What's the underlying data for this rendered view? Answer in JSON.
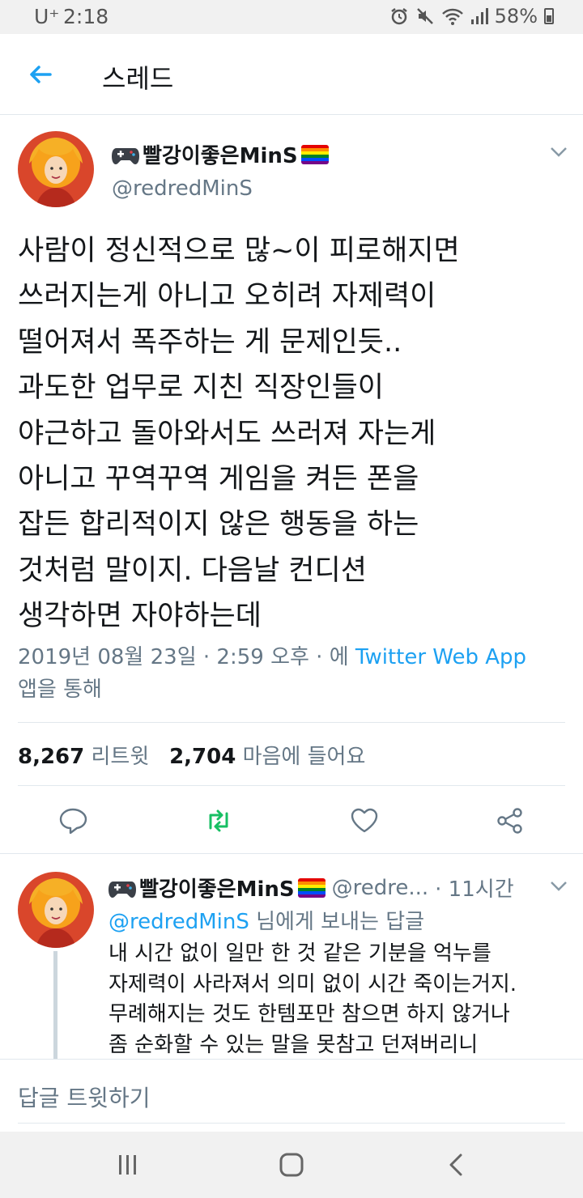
{
  "status_bar": {
    "carrier": "U⁺",
    "time": "2:18",
    "battery": "58%"
  },
  "header": {
    "title": "스레드",
    "back_icon": "arrow-left-icon"
  },
  "tweet": {
    "display_name": "빨강이좋은MinS",
    "handle": "@redredMinS",
    "text_lines": [
      "사람이 정신적으로 많~이 피로해지면",
      "쓰러지는게 아니고 오히려 자제력이",
      "떨어져서 폭주하는 게 문제인듯..",
      "과도한 업무로 지친 직장인들이",
      "야근하고 돌아와서도 쓰러져 자는게",
      "아니고 꾸역꾸역 게임을 켜든 폰을",
      "잡든 합리적이지 않은 행동을 하는",
      "것처럼 말이지. 다음날 컨디션",
      "생각하면 자야하는데"
    ],
    "timestamp": "2019년 08월 23일 · 2:59 오후 · 에",
    "source": "Twitter Web App",
    "via": "앱을 통해",
    "retweet_count": "8,267",
    "retweet_label": "리트윗",
    "like_count": "2,704",
    "like_label": "마음에 들어요"
  },
  "reply": {
    "display_name": "빨강이좋은MinS",
    "handle": "@redre...",
    "time": "· 11시간",
    "reply_to_handle": "@redredMinS",
    "reply_to_suffix": "님에게 보내는 답글",
    "text_lines": [
      "내 시간 없이 일만 한 것 같은 기분을 억누를",
      "자제력이 사라져서 의미 없이 시간 죽이는거지.",
      "무례해지는 것도 한템포만 참으면 하지 않거나",
      "좀 순화할 수 있는 말을 못참고 던져버리니"
    ]
  },
  "compose": {
    "placeholder": "답글 트윗하기"
  },
  "colors": {
    "accent": "#1da1f2",
    "retweet_green": "#17bf63",
    "secondary_text": "#657786"
  }
}
